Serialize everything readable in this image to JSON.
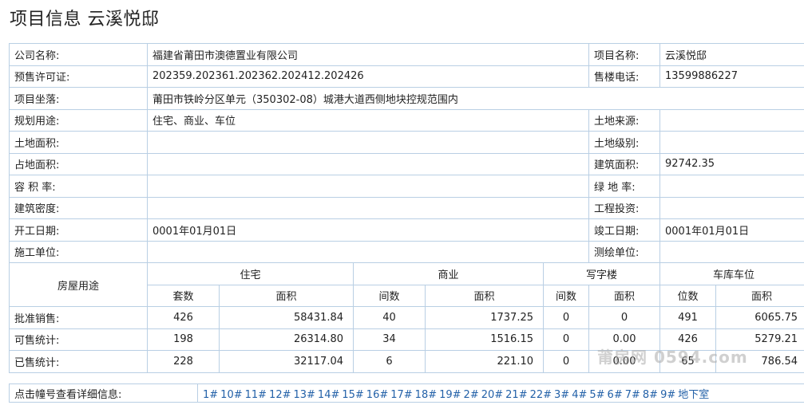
{
  "page_title": "项目信息 云溪悦邸",
  "info_rows": [
    {
      "l1": "公司名称:",
      "v1": "福建省莆田市澳德置业有限公司",
      "l2": "项目名称:",
      "v2": "云溪悦邸"
    },
    {
      "l1": "预售许可证:",
      "v1": "202359.202361.202362.202412.202426",
      "l2": "售楼电话:",
      "v2": "13599886227"
    },
    {
      "l1": "项目坐落:",
      "v1": "莆田市铁岭分区单元（350302-08）城港大道西侧地块控规范围内"
    },
    {
      "l1": "规划用途:",
      "v1": "住宅、商业、车位",
      "l2": "土地来源:",
      "v2": ""
    },
    {
      "l1": "土地面积:",
      "v1": "",
      "l2": "土地级别:",
      "v2": ""
    },
    {
      "l1": "占地面积:",
      "v1": "",
      "l2": "建筑面积:",
      "v2": "92742.35"
    },
    {
      "l1": "容 积 率:",
      "v1": "",
      "l2": "绿 地 率:",
      "v2": ""
    },
    {
      "l1": "建筑密度:",
      "v1": "",
      "l2": "工程投资:",
      "v2": ""
    },
    {
      "l1": "开工日期:",
      "v1": "0001年01月01日",
      "l2": "竣工日期:",
      "v2": "0001年01月01日"
    },
    {
      "l1": "施工单位:",
      "v1": "",
      "l2": "测绘单位:",
      "v2": ""
    }
  ],
  "stats": {
    "row_header": "房屋用途",
    "groups": [
      "住宅",
      "商业",
      "写字楼",
      "车库车位"
    ],
    "subheaders": [
      "套数",
      "面积",
      "间数",
      "面积",
      "间数",
      "面积",
      "位数",
      "面积"
    ],
    "rows": [
      {
        "label": "批准销售:",
        "values": [
          "426",
          "58431.84",
          "40",
          "1737.25",
          "0",
          "0",
          "491",
          "6065.75"
        ]
      },
      {
        "label": "可售统计:",
        "values": [
          "198",
          "26314.80",
          "34",
          "1516.15",
          "0",
          "0.00",
          "426",
          "5279.21"
        ]
      },
      {
        "label": "已售统计:",
        "values": [
          "228",
          "32117.04",
          "6",
          "221.10",
          "0",
          "0.00",
          "65",
          "786.54"
        ]
      }
    ]
  },
  "buildings": {
    "label": "点击幢号查看详细信息:",
    "links": [
      "1#",
      "10#",
      "11#",
      "12#",
      "13#",
      "14#",
      "15#",
      "16#",
      "17#",
      "18#",
      "19#",
      "2#",
      "20#",
      "21#",
      "22#",
      "3#",
      "4#",
      "5#",
      "6#",
      "7#",
      "8#",
      "9#",
      "地下室"
    ]
  },
  "watermark": "莆房网 0594.com"
}
